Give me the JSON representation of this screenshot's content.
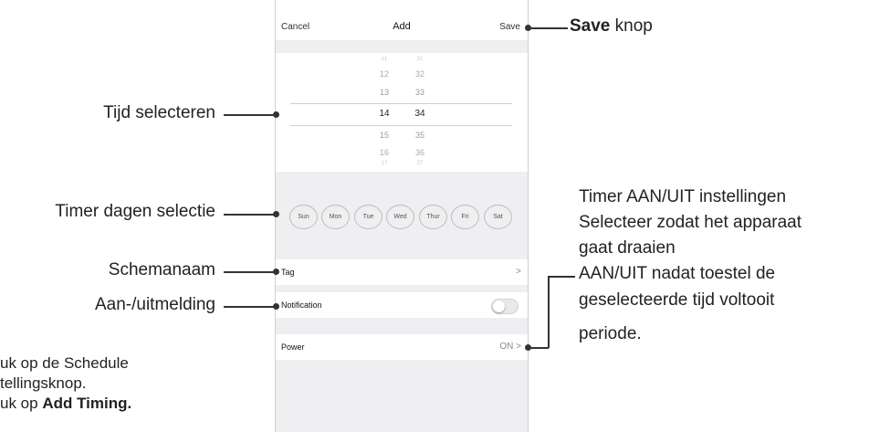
{
  "phone": {
    "header": {
      "cancel": "Cancel",
      "title": "Add",
      "save": "Save"
    },
    "picker": {
      "rows": [
        {
          "hour": "11",
          "minute": "31"
        },
        {
          "hour": "12",
          "minute": "32"
        },
        {
          "hour": "13",
          "minute": "33"
        },
        {
          "hour": "14",
          "minute": "34",
          "selected": true
        },
        {
          "hour": "15",
          "minute": "35"
        },
        {
          "hour": "16",
          "minute": "36"
        },
        {
          "hour": "17",
          "minute": "37"
        }
      ]
    },
    "days": [
      "Sun",
      "Mon",
      "Tue",
      "Wed",
      "Thur",
      "Fri",
      "Sat"
    ],
    "tag": {
      "label": "Tag",
      "chevron": ">"
    },
    "notification": {
      "label": "Notification",
      "enabled": false
    },
    "power": {
      "label": "Power",
      "value": "ON",
      "chevron": ">"
    }
  },
  "annotations": {
    "save_bold": "Save",
    "save_rest": " knop",
    "time_select": "Tijd selecteren",
    "days_select": "Timer dagen selectie",
    "schedule_name": "Schemanaam",
    "notification": "Aan-/uitmelding",
    "timer_line1": "Timer AAN/UIT instellingen",
    "timer_line2": "Selecteer zodat het apparaat",
    "timer_line3": "gaat draaien",
    "timer_line4": "AAN/UIT nadat toestel de",
    "timer_line5": "geselecteerde tijd voltooit",
    "timer_line6": "periode.",
    "left_line1": "uk op de Schedule",
    "left_line2": "tellingsknop.",
    "left_line3_pre": "uk op ",
    "left_line3_bold": "Add Timing."
  },
  "colors": {
    "panel_bg": "#efeff1",
    "annotation_line": "#333333"
  }
}
